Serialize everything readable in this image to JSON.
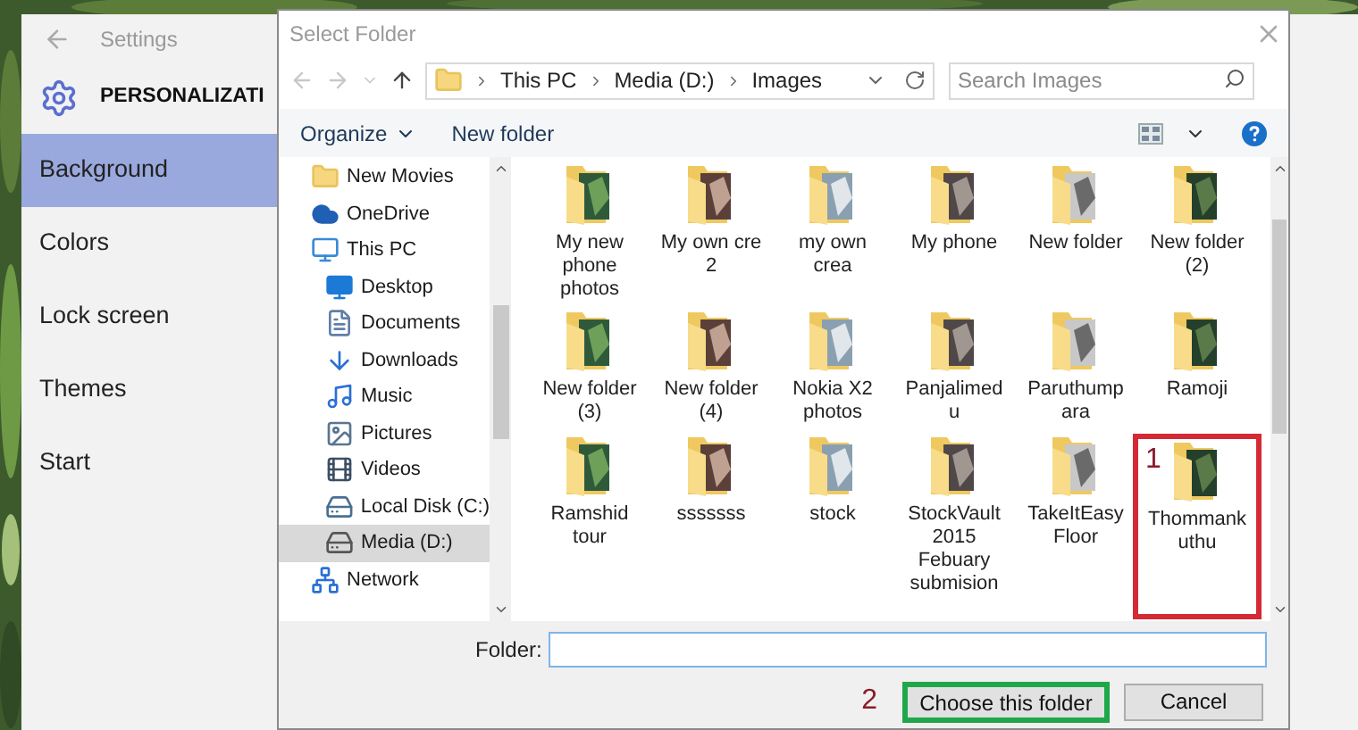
{
  "settings": {
    "title": "Settings",
    "heading": "PERSONALIZATI",
    "nav": [
      {
        "label": "Background",
        "selected": true
      },
      {
        "label": "Colors",
        "selected": false
      },
      {
        "label": "Lock screen",
        "selected": false
      },
      {
        "label": "Themes",
        "selected": false
      },
      {
        "label": "Start",
        "selected": false
      }
    ]
  },
  "dialog": {
    "title": "Select Folder",
    "breadcrumb": [
      "This PC",
      "Media (D:)",
      "Images"
    ],
    "search": {
      "placeholder": "Search Images"
    },
    "toolbar": [
      {
        "label": "Organize",
        "kind": "menu"
      },
      {
        "label": "New folder",
        "kind": "button"
      }
    ],
    "nav_tree": [
      {
        "children": [
          {
            "label": "New Movies",
            "kind": "folder",
            "selected": false
          }
        ]
      },
      {
        "label": "OneDrive",
        "kind": "cloud",
        "selected": false
      },
      {
        "label": "This PC",
        "kind": "pc",
        "selected": false,
        "children": [
          {
            "label": "Desktop",
            "kind": "desktop",
            "selected": false
          },
          {
            "label": "Documents",
            "kind": "documents",
            "selected": false
          },
          {
            "label": "Downloads",
            "kind": "downloads",
            "selected": false
          },
          {
            "label": "Music",
            "kind": "music",
            "selected": false
          },
          {
            "label": "Pictures",
            "kind": "pictures",
            "selected": false
          },
          {
            "label": "Videos",
            "kind": "videos",
            "selected": false
          },
          {
            "label": "Local Disk (C:)",
            "kind": "disk_c",
            "selected": false
          },
          {
            "label": "Media (D:)",
            "kind": "disk",
            "selected": true
          }
        ]
      },
      {
        "label": "Network",
        "kind": "network",
        "selected": false
      }
    ],
    "folders": [
      {
        "name": "My new phone photos"
      },
      {
        "name": "My own cre 2"
      },
      {
        "name": "my own crea"
      },
      {
        "name": "My phone"
      },
      {
        "name": "New folder"
      },
      {
        "name": "New folder (2)"
      },
      {
        "name": "New folder (3)"
      },
      {
        "name": "New folder (4)"
      },
      {
        "name": "Nokia X2 photos"
      },
      {
        "name": "Panjalimedu"
      },
      {
        "name": "Paruthumpara"
      },
      {
        "name": "Ramoji"
      },
      {
        "name": "Ramshid tour"
      },
      {
        "name": "sssssss"
      },
      {
        "name": "stock"
      },
      {
        "name": "StockVault 2015 Febuary submision"
      },
      {
        "name": "TakeItEasy Floor"
      },
      {
        "name": "Thommankuthu",
        "marker": "1"
      }
    ],
    "folder_field": {
      "label": "Folder:"
    },
    "buttons": [
      {
        "label": "Choose this folder",
        "marker": "2"
      },
      {
        "label": "Cancel"
      }
    ]
  }
}
